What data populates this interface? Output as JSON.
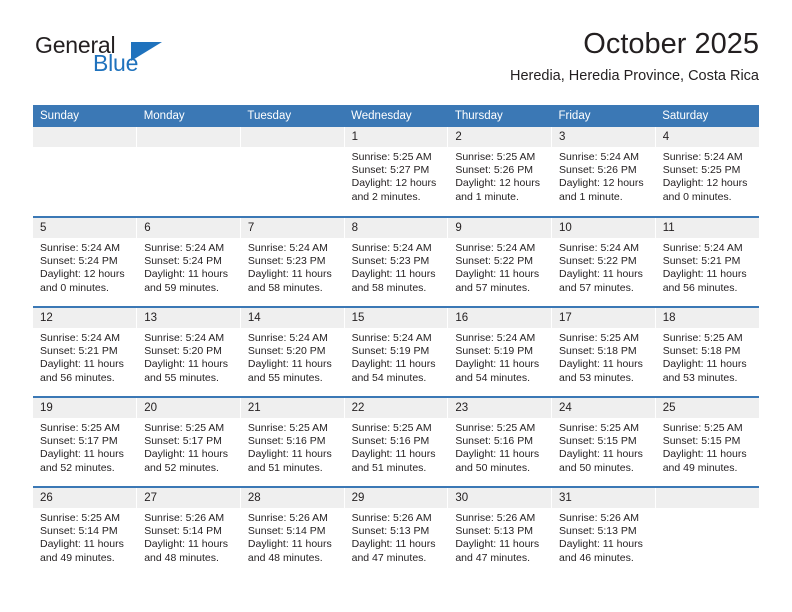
{
  "branding": {
    "logo_text_1": "General",
    "logo_text_2": "Blue",
    "logo_color_dark": "#231f20",
    "logo_color_blue": "#1f72bd"
  },
  "header": {
    "title": "October 2025",
    "subtitle": "Heredia, Heredia Province, Costa Rica"
  },
  "theme": {
    "header_band": "#3b78b5",
    "date_strip": "#efefef",
    "text": "#231f20"
  },
  "weekday_headers": [
    "Sunday",
    "Monday",
    "Tuesday",
    "Wednesday",
    "Thursday",
    "Friday",
    "Saturday"
  ],
  "weeks": [
    [
      {
        "date": "",
        "empty": true,
        "sunrise": "",
        "sunset": "",
        "daylight_line1": "",
        "daylight_line2": ""
      },
      {
        "date": "",
        "empty": true,
        "sunrise": "",
        "sunset": "",
        "daylight_line1": "",
        "daylight_line2": ""
      },
      {
        "date": "",
        "empty": true,
        "sunrise": "",
        "sunset": "",
        "daylight_line1": "",
        "daylight_line2": ""
      },
      {
        "date": "1",
        "empty": false,
        "sunrise": "Sunrise: 5:25 AM",
        "sunset": "Sunset: 5:27 PM",
        "daylight_line1": "Daylight: 12 hours",
        "daylight_line2": "and 2 minutes."
      },
      {
        "date": "2",
        "empty": false,
        "sunrise": "Sunrise: 5:25 AM",
        "sunset": "Sunset: 5:26 PM",
        "daylight_line1": "Daylight: 12 hours",
        "daylight_line2": "and 1 minute."
      },
      {
        "date": "3",
        "empty": false,
        "sunrise": "Sunrise: 5:24 AM",
        "sunset": "Sunset: 5:26 PM",
        "daylight_line1": "Daylight: 12 hours",
        "daylight_line2": "and 1 minute."
      },
      {
        "date": "4",
        "empty": false,
        "sunrise": "Sunrise: 5:24 AM",
        "sunset": "Sunset: 5:25 PM",
        "daylight_line1": "Daylight: 12 hours",
        "daylight_line2": "and 0 minutes."
      }
    ],
    [
      {
        "date": "5",
        "empty": false,
        "sunrise": "Sunrise: 5:24 AM",
        "sunset": "Sunset: 5:24 PM",
        "daylight_line1": "Daylight: 12 hours",
        "daylight_line2": "and 0 minutes."
      },
      {
        "date": "6",
        "empty": false,
        "sunrise": "Sunrise: 5:24 AM",
        "sunset": "Sunset: 5:24 PM",
        "daylight_line1": "Daylight: 11 hours",
        "daylight_line2": "and 59 minutes."
      },
      {
        "date": "7",
        "empty": false,
        "sunrise": "Sunrise: 5:24 AM",
        "sunset": "Sunset: 5:23 PM",
        "daylight_line1": "Daylight: 11 hours",
        "daylight_line2": "and 58 minutes."
      },
      {
        "date": "8",
        "empty": false,
        "sunrise": "Sunrise: 5:24 AM",
        "sunset": "Sunset: 5:23 PM",
        "daylight_line1": "Daylight: 11 hours",
        "daylight_line2": "and 58 minutes."
      },
      {
        "date": "9",
        "empty": false,
        "sunrise": "Sunrise: 5:24 AM",
        "sunset": "Sunset: 5:22 PM",
        "daylight_line1": "Daylight: 11 hours",
        "daylight_line2": "and 57 minutes."
      },
      {
        "date": "10",
        "empty": false,
        "sunrise": "Sunrise: 5:24 AM",
        "sunset": "Sunset: 5:22 PM",
        "daylight_line1": "Daylight: 11 hours",
        "daylight_line2": "and 57 minutes."
      },
      {
        "date": "11",
        "empty": false,
        "sunrise": "Sunrise: 5:24 AM",
        "sunset": "Sunset: 5:21 PM",
        "daylight_line1": "Daylight: 11 hours",
        "daylight_line2": "and 56 minutes."
      }
    ],
    [
      {
        "date": "12",
        "empty": false,
        "sunrise": "Sunrise: 5:24 AM",
        "sunset": "Sunset: 5:21 PM",
        "daylight_line1": "Daylight: 11 hours",
        "daylight_line2": "and 56 minutes."
      },
      {
        "date": "13",
        "empty": false,
        "sunrise": "Sunrise: 5:24 AM",
        "sunset": "Sunset: 5:20 PM",
        "daylight_line1": "Daylight: 11 hours",
        "daylight_line2": "and 55 minutes."
      },
      {
        "date": "14",
        "empty": false,
        "sunrise": "Sunrise: 5:24 AM",
        "sunset": "Sunset: 5:20 PM",
        "daylight_line1": "Daylight: 11 hours",
        "daylight_line2": "and 55 minutes."
      },
      {
        "date": "15",
        "empty": false,
        "sunrise": "Sunrise: 5:24 AM",
        "sunset": "Sunset: 5:19 PM",
        "daylight_line1": "Daylight: 11 hours",
        "daylight_line2": "and 54 minutes."
      },
      {
        "date": "16",
        "empty": false,
        "sunrise": "Sunrise: 5:24 AM",
        "sunset": "Sunset: 5:19 PM",
        "daylight_line1": "Daylight: 11 hours",
        "daylight_line2": "and 54 minutes."
      },
      {
        "date": "17",
        "empty": false,
        "sunrise": "Sunrise: 5:25 AM",
        "sunset": "Sunset: 5:18 PM",
        "daylight_line1": "Daylight: 11 hours",
        "daylight_line2": "and 53 minutes."
      },
      {
        "date": "18",
        "empty": false,
        "sunrise": "Sunrise: 5:25 AM",
        "sunset": "Sunset: 5:18 PM",
        "daylight_line1": "Daylight: 11 hours",
        "daylight_line2": "and 53 minutes."
      }
    ],
    [
      {
        "date": "19",
        "empty": false,
        "sunrise": "Sunrise: 5:25 AM",
        "sunset": "Sunset: 5:17 PM",
        "daylight_line1": "Daylight: 11 hours",
        "daylight_line2": "and 52 minutes."
      },
      {
        "date": "20",
        "empty": false,
        "sunrise": "Sunrise: 5:25 AM",
        "sunset": "Sunset: 5:17 PM",
        "daylight_line1": "Daylight: 11 hours",
        "daylight_line2": "and 52 minutes."
      },
      {
        "date": "21",
        "empty": false,
        "sunrise": "Sunrise: 5:25 AM",
        "sunset": "Sunset: 5:16 PM",
        "daylight_line1": "Daylight: 11 hours",
        "daylight_line2": "and 51 minutes."
      },
      {
        "date": "22",
        "empty": false,
        "sunrise": "Sunrise: 5:25 AM",
        "sunset": "Sunset: 5:16 PM",
        "daylight_line1": "Daylight: 11 hours",
        "daylight_line2": "and 51 minutes."
      },
      {
        "date": "23",
        "empty": false,
        "sunrise": "Sunrise: 5:25 AM",
        "sunset": "Sunset: 5:16 PM",
        "daylight_line1": "Daylight: 11 hours",
        "daylight_line2": "and 50 minutes."
      },
      {
        "date": "24",
        "empty": false,
        "sunrise": "Sunrise: 5:25 AM",
        "sunset": "Sunset: 5:15 PM",
        "daylight_line1": "Daylight: 11 hours",
        "daylight_line2": "and 50 minutes."
      },
      {
        "date": "25",
        "empty": false,
        "sunrise": "Sunrise: 5:25 AM",
        "sunset": "Sunset: 5:15 PM",
        "daylight_line1": "Daylight: 11 hours",
        "daylight_line2": "and 49 minutes."
      }
    ],
    [
      {
        "date": "26",
        "empty": false,
        "sunrise": "Sunrise: 5:25 AM",
        "sunset": "Sunset: 5:14 PM",
        "daylight_line1": "Daylight: 11 hours",
        "daylight_line2": "and 49 minutes."
      },
      {
        "date": "27",
        "empty": false,
        "sunrise": "Sunrise: 5:26 AM",
        "sunset": "Sunset: 5:14 PM",
        "daylight_line1": "Daylight: 11 hours",
        "daylight_line2": "and 48 minutes."
      },
      {
        "date": "28",
        "empty": false,
        "sunrise": "Sunrise: 5:26 AM",
        "sunset": "Sunset: 5:14 PM",
        "daylight_line1": "Daylight: 11 hours",
        "daylight_line2": "and 48 minutes."
      },
      {
        "date": "29",
        "empty": false,
        "sunrise": "Sunrise: 5:26 AM",
        "sunset": "Sunset: 5:13 PM",
        "daylight_line1": "Daylight: 11 hours",
        "daylight_line2": "and 47 minutes."
      },
      {
        "date": "30",
        "empty": false,
        "sunrise": "Sunrise: 5:26 AM",
        "sunset": "Sunset: 5:13 PM",
        "daylight_line1": "Daylight: 11 hours",
        "daylight_line2": "and 47 minutes."
      },
      {
        "date": "31",
        "empty": false,
        "sunrise": "Sunrise: 5:26 AM",
        "sunset": "Sunset: 5:13 PM",
        "daylight_line1": "Daylight: 11 hours",
        "daylight_line2": "and 46 minutes."
      },
      {
        "date": "",
        "empty": true,
        "sunrise": "",
        "sunset": "",
        "daylight_line1": "",
        "daylight_line2": ""
      }
    ]
  ]
}
